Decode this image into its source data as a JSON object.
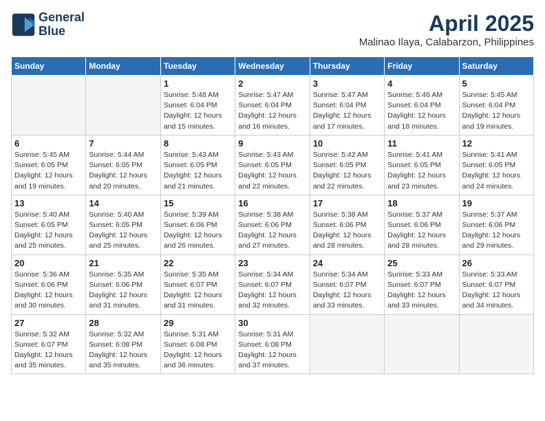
{
  "header": {
    "logo_line1": "General",
    "logo_line2": "Blue",
    "month_title": "April 2025",
    "location": "Malinao Ilaya, Calabarzon, Philippines"
  },
  "weekdays": [
    "Sunday",
    "Monday",
    "Tuesday",
    "Wednesday",
    "Thursday",
    "Friday",
    "Saturday"
  ],
  "weeks": [
    [
      {
        "day": "",
        "sunrise": "",
        "sunset": "",
        "daylight": ""
      },
      {
        "day": "",
        "sunrise": "",
        "sunset": "",
        "daylight": ""
      },
      {
        "day": "1",
        "sunrise": "Sunrise: 5:48 AM",
        "sunset": "Sunset: 6:04 PM",
        "daylight": "Daylight: 12 hours and 15 minutes."
      },
      {
        "day": "2",
        "sunrise": "Sunrise: 5:47 AM",
        "sunset": "Sunset: 6:04 PM",
        "daylight": "Daylight: 12 hours and 16 minutes."
      },
      {
        "day": "3",
        "sunrise": "Sunrise: 5:47 AM",
        "sunset": "Sunset: 6:04 PM",
        "daylight": "Daylight: 12 hours and 17 minutes."
      },
      {
        "day": "4",
        "sunrise": "Sunrise: 5:46 AM",
        "sunset": "Sunset: 6:04 PM",
        "daylight": "Daylight: 12 hours and 18 minutes."
      },
      {
        "day": "5",
        "sunrise": "Sunrise: 5:45 AM",
        "sunset": "Sunset: 6:04 PM",
        "daylight": "Daylight: 12 hours and 19 minutes."
      }
    ],
    [
      {
        "day": "6",
        "sunrise": "Sunrise: 5:45 AM",
        "sunset": "Sunset: 6:05 PM",
        "daylight": "Daylight: 12 hours and 19 minutes."
      },
      {
        "day": "7",
        "sunrise": "Sunrise: 5:44 AM",
        "sunset": "Sunset: 6:05 PM",
        "daylight": "Daylight: 12 hours and 20 minutes."
      },
      {
        "day": "8",
        "sunrise": "Sunrise: 5:43 AM",
        "sunset": "Sunset: 6:05 PM",
        "daylight": "Daylight: 12 hours and 21 minutes."
      },
      {
        "day": "9",
        "sunrise": "Sunrise: 5:43 AM",
        "sunset": "Sunset: 6:05 PM",
        "daylight": "Daylight: 12 hours and 22 minutes."
      },
      {
        "day": "10",
        "sunrise": "Sunrise: 5:42 AM",
        "sunset": "Sunset: 6:05 PM",
        "daylight": "Daylight: 12 hours and 22 minutes."
      },
      {
        "day": "11",
        "sunrise": "Sunrise: 5:41 AM",
        "sunset": "Sunset: 6:05 PM",
        "daylight": "Daylight: 12 hours and 23 minutes."
      },
      {
        "day": "12",
        "sunrise": "Sunrise: 5:41 AM",
        "sunset": "Sunset: 6:05 PM",
        "daylight": "Daylight: 12 hours and 24 minutes."
      }
    ],
    [
      {
        "day": "13",
        "sunrise": "Sunrise: 5:40 AM",
        "sunset": "Sunset: 6:05 PM",
        "daylight": "Daylight: 12 hours and 25 minutes."
      },
      {
        "day": "14",
        "sunrise": "Sunrise: 5:40 AM",
        "sunset": "Sunset: 6:05 PM",
        "daylight": "Daylight: 12 hours and 25 minutes."
      },
      {
        "day": "15",
        "sunrise": "Sunrise: 5:39 AM",
        "sunset": "Sunset: 6:06 PM",
        "daylight": "Daylight: 12 hours and 26 minutes."
      },
      {
        "day": "16",
        "sunrise": "Sunrise: 5:38 AM",
        "sunset": "Sunset: 6:06 PM",
        "daylight": "Daylight: 12 hours and 27 minutes."
      },
      {
        "day": "17",
        "sunrise": "Sunrise: 5:38 AM",
        "sunset": "Sunset: 6:06 PM",
        "daylight": "Daylight: 12 hours and 28 minutes."
      },
      {
        "day": "18",
        "sunrise": "Sunrise: 5:37 AM",
        "sunset": "Sunset: 6:06 PM",
        "daylight": "Daylight: 12 hours and 28 minutes."
      },
      {
        "day": "19",
        "sunrise": "Sunrise: 5:37 AM",
        "sunset": "Sunset: 6:06 PM",
        "daylight": "Daylight: 12 hours and 29 minutes."
      }
    ],
    [
      {
        "day": "20",
        "sunrise": "Sunrise: 5:36 AM",
        "sunset": "Sunset: 6:06 PM",
        "daylight": "Daylight: 12 hours and 30 minutes."
      },
      {
        "day": "21",
        "sunrise": "Sunrise: 5:35 AM",
        "sunset": "Sunset: 6:06 PM",
        "daylight": "Daylight: 12 hours and 31 minutes."
      },
      {
        "day": "22",
        "sunrise": "Sunrise: 5:35 AM",
        "sunset": "Sunset: 6:07 PM",
        "daylight": "Daylight: 12 hours and 31 minutes."
      },
      {
        "day": "23",
        "sunrise": "Sunrise: 5:34 AM",
        "sunset": "Sunset: 6:07 PM",
        "daylight": "Daylight: 12 hours and 32 minutes."
      },
      {
        "day": "24",
        "sunrise": "Sunrise: 5:34 AM",
        "sunset": "Sunset: 6:07 PM",
        "daylight": "Daylight: 12 hours and 33 minutes."
      },
      {
        "day": "25",
        "sunrise": "Sunrise: 5:33 AM",
        "sunset": "Sunset: 6:07 PM",
        "daylight": "Daylight: 12 hours and 33 minutes."
      },
      {
        "day": "26",
        "sunrise": "Sunrise: 5:33 AM",
        "sunset": "Sunset: 6:07 PM",
        "daylight": "Daylight: 12 hours and 34 minutes."
      }
    ],
    [
      {
        "day": "27",
        "sunrise": "Sunrise: 5:32 AM",
        "sunset": "Sunset: 6:07 PM",
        "daylight": "Daylight: 12 hours and 35 minutes."
      },
      {
        "day": "28",
        "sunrise": "Sunrise: 5:32 AM",
        "sunset": "Sunset: 6:08 PM",
        "daylight": "Daylight: 12 hours and 35 minutes."
      },
      {
        "day": "29",
        "sunrise": "Sunrise: 5:31 AM",
        "sunset": "Sunset: 6:08 PM",
        "daylight": "Daylight: 12 hours and 36 minutes."
      },
      {
        "day": "30",
        "sunrise": "Sunrise: 5:31 AM",
        "sunset": "Sunset: 6:08 PM",
        "daylight": "Daylight: 12 hours and 37 minutes."
      },
      {
        "day": "",
        "sunrise": "",
        "sunset": "",
        "daylight": ""
      },
      {
        "day": "",
        "sunrise": "",
        "sunset": "",
        "daylight": ""
      },
      {
        "day": "",
        "sunrise": "",
        "sunset": "",
        "daylight": ""
      }
    ]
  ]
}
